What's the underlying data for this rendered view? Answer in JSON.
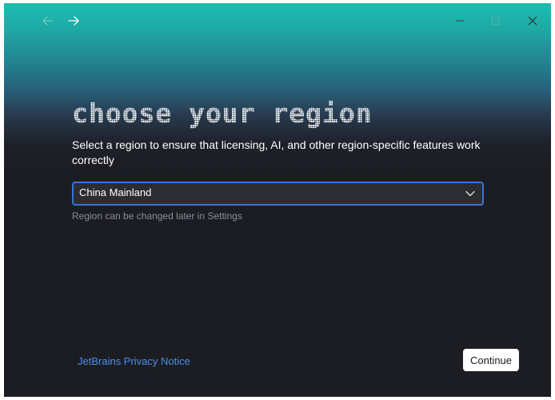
{
  "window": {
    "nav_back_icon": "arrow-left-icon",
    "nav_forward_icon": "arrow-right-icon",
    "controls": [
      "minimize-icon",
      "maximize-icon",
      "close-icon"
    ]
  },
  "page": {
    "title": "choose your region",
    "subtitle": "Select a region to ensure that licensing, AI, and other region-specific features work correctly",
    "region_select": {
      "selected": "China Mainland"
    },
    "hint": "Region can be changed later in Settings"
  },
  "footer": {
    "privacy_link": "JetBrains Privacy Notice",
    "continue_label": "Continue"
  },
  "colors": {
    "gradient_top": "#1bbdb1",
    "background": "#1c1d22",
    "focus_border": "#3874d8",
    "link": "#4c8ff0"
  }
}
